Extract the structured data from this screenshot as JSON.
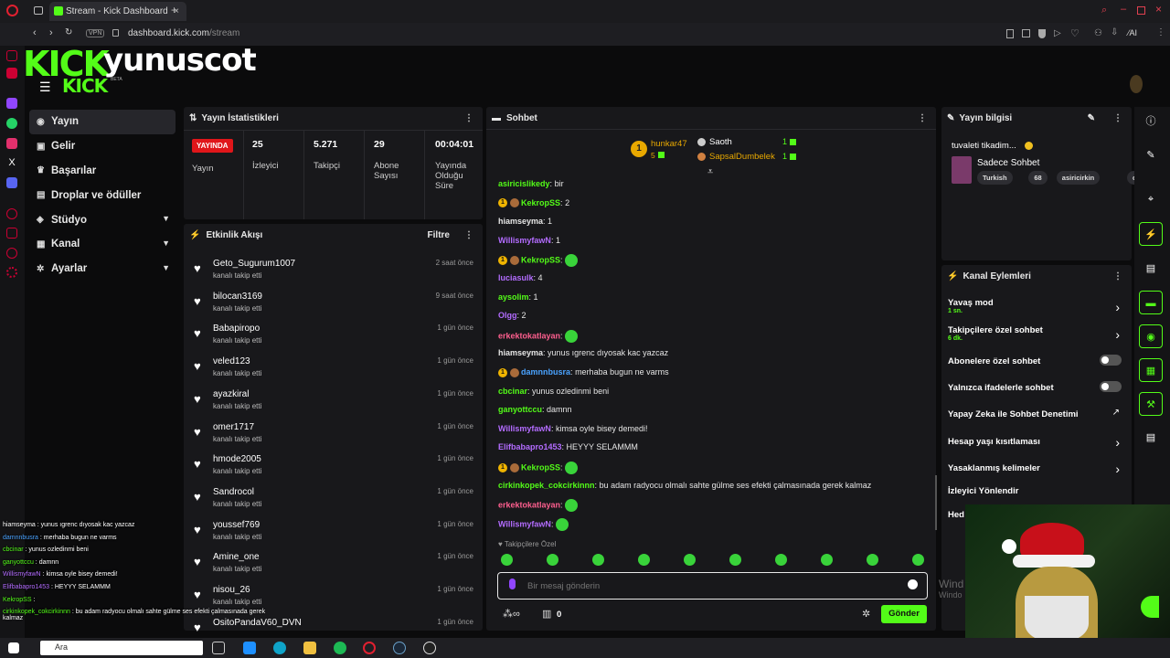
{
  "browser": {
    "tab_title": "Stream - Kick Dashboard",
    "url_host": "dashboard.kick.com",
    "url_path": "/stream",
    "vpn": "VPN",
    "new_tab": "+",
    "ai": "AI"
  },
  "overlay": {
    "logo": "KICK",
    "name": "yunuscot",
    "small_logo": "KICK",
    "beta": "BETA"
  },
  "nav": [
    {
      "label": "Yayın",
      "icon": "broadcast-icon"
    },
    {
      "label": "Gelir",
      "icon": "revenue-icon"
    },
    {
      "label": "Başarılar",
      "icon": "trophy-icon"
    },
    {
      "label": "Droplar ve ödüller",
      "icon": "drops-icon"
    },
    {
      "label": "Stüdyo",
      "icon": "studio-icon"
    },
    {
      "label": "Kanal",
      "icon": "channel-icon"
    },
    {
      "label": "Ayarlar",
      "icon": "settings-icon"
    }
  ],
  "stats": {
    "title": "Yayın İstatistikleri",
    "live": "YAYINDA",
    "live_label": "Yayın",
    "viewers": "25",
    "viewers_label": "İzleyici",
    "followers": "5.271",
    "followers_label": "Takipçi",
    "subs": "29",
    "subs_label": "Abone Sayısı",
    "uptime": "00:04:01",
    "uptime_label": "Yayında Olduğu Süre"
  },
  "feed": {
    "title": "Etkinlik Akışı",
    "filter": "Filtre",
    "items": [
      {
        "name": "Geto_Sugurum1007",
        "sub": "kanalı takip etti",
        "time": "2 saat önce"
      },
      {
        "name": "bilocan3169",
        "sub": "kanalı takip etti",
        "time": "9 saat önce"
      },
      {
        "name": "Babapiropo",
        "sub": "kanalı takip etti",
        "time": "1 gün önce"
      },
      {
        "name": "veled123",
        "sub": "kanalı takip etti",
        "time": "1 gün önce"
      },
      {
        "name": "ayazkiral",
        "sub": "kanalı takip etti",
        "time": "1 gün önce"
      },
      {
        "name": "omer1717",
        "sub": "kanalı takip etti",
        "time": "1 gün önce"
      },
      {
        "name": "hmode2005",
        "sub": "kanalı takip etti",
        "time": "1 gün önce"
      },
      {
        "name": "Sandrocol",
        "sub": "kanalı takip etti",
        "time": "1 gün önce"
      },
      {
        "name": "youssef769",
        "sub": "kanalı takip etti",
        "time": "1 gün önce"
      },
      {
        "name": "Amine_one",
        "sub": "kanalı takip etti",
        "time": "1 gün önce"
      },
      {
        "name": "nisou_26",
        "sub": "kanalı takip etti",
        "time": "1 gün önce"
      },
      {
        "name": "OsitoPandaV60_DVN",
        "sub": "",
        "time": "1 gün önce"
      }
    ]
  },
  "chat": {
    "title": "Sohbet",
    "top1_name": "hunkar47",
    "top1_count": "5",
    "top2_name": "Saoth",
    "top2_count": "1",
    "top3_name": "SapsalDumbelek",
    "top3_count": "1",
    "rank": "1",
    "messages": [
      {
        "user": "asiricislikedy",
        "color": "#53fc18",
        "text": "bir",
        "badges": false
      },
      {
        "user": "KekropSS",
        "color": "#53fc18",
        "text": "2",
        "badges": true
      },
      {
        "user": "hiamseyma",
        "color": "#e6e6e6",
        "text": "1",
        "badges": false
      },
      {
        "user": "WillismyfawN",
        "color": "#b36cff",
        "text": "1",
        "badges": false
      },
      {
        "user": "KekropSS",
        "color": "#53fc18",
        "text": "",
        "badges": true,
        "emote": true
      },
      {
        "user": "luciasulk",
        "color": "#b36cff",
        "text": "4",
        "badges": false
      },
      {
        "user": "aysolim",
        "color": "#53fc18",
        "text": "1",
        "badges": false
      },
      {
        "user": "Olgg",
        "color": "#b36cff",
        "text": "2",
        "badges": false
      },
      {
        "user": "erkektokatlayan",
        "color": "#ff5f8f",
        "text": "",
        "badges": false,
        "emote": true
      },
      {
        "user": "hiamseyma",
        "color": "#e6e6e6",
        "text": "yunus ıgrenc dıyosak kac yazcaz",
        "badges": false
      },
      {
        "user": "damnnbusra",
        "color": "#4aa3ff",
        "text": "merhaba bugun ne varms",
        "badges": true
      },
      {
        "user": "cbcinar",
        "color": "#53fc18",
        "text": "yunus ozledinmi beni",
        "badges": false
      },
      {
        "user": "ganyottccu",
        "color": "#53fc18",
        "text": "damnn",
        "badges": false
      },
      {
        "user": "WillismyfawN",
        "color": "#b36cff",
        "text": "kimsa oyle bisey demedi!",
        "badges": false
      },
      {
        "user": "Elifbabapro1453",
        "color": "#b36cff",
        "text": "HEYYY SELAMMM",
        "badges": false
      },
      {
        "user": "KekropSS",
        "color": "#53fc18",
        "text": "",
        "badges": true,
        "emote": true
      },
      {
        "user": "cirkinkopek_cokcirkinnn",
        "color": "#53fc18",
        "text": "bu adam radyocu olmalı sahte gülme ses efekti çalmasınada gerek kalmaz",
        "badges": false
      },
      {
        "user": "erkektokatlayan",
        "color": "#ff5f8f",
        "text": "",
        "badges": false,
        "emote": true
      },
      {
        "user": "WillismyfawN",
        "color": "#b36cff",
        "text": "",
        "badges": false,
        "emote": true
      }
    ],
    "followers_only": "Takipçilere Özel",
    "placeholder": "Bir mesaj gönderin",
    "send": "Gönder",
    "count": "0"
  },
  "info": {
    "title": "Yayın bilgisi",
    "stream_title": "tuvaleti tikadim...",
    "category": "Sadece Sohbet",
    "tags": [
      "Turkish",
      "68",
      "asiricirkin",
      "cirkin"
    ]
  },
  "actions": {
    "title": "Kanal Eylemleri",
    "items": [
      {
        "label": "Yavaş mod",
        "sub": "1 sn.",
        "kind": "arrow"
      },
      {
        "label": "Takipçilere özel sohbet",
        "sub": "6 dk.",
        "kind": "arrow"
      },
      {
        "label": "Abonelere özel sohbet",
        "sub": "",
        "kind": "toggle"
      },
      {
        "label": "Yalnızca ifadelerle sohbet",
        "sub": "",
        "kind": "toggle"
      },
      {
        "label": "Yapay Zeka ile Sohbet Denetimi",
        "sub": "",
        "kind": "external"
      },
      {
        "label": "Hesap yaşı kısıtlaması",
        "sub": "",
        "kind": "arrow"
      },
      {
        "label": "Yasaklanmış kelimeler",
        "sub": "",
        "kind": "arrow"
      },
      {
        "label": "İzleyici Yönlendir",
        "sub": "",
        "kind": "none"
      },
      {
        "label": "Hed",
        "sub": "",
        "kind": "none"
      }
    ]
  },
  "overlay_chat": [
    {
      "user": "hiamseyma",
      "text": "yunus ıgrenc dıyosak kac yazcaz",
      "color": "#ffffff"
    },
    {
      "user": "damnnbusra",
      "text": "merhaba bugun ne varms",
      "color": "#4aa3ff"
    },
    {
      "user": "cbcinar",
      "text": "yunus ozledinmi beni",
      "color": "#53fc18"
    },
    {
      "user": "ganyottccu",
      "text": "damnn",
      "color": "#53fc18"
    },
    {
      "user": "WillismyfawN",
      "text": "kimsa oyle bisey demedi!",
      "color": "#b36cff"
    },
    {
      "user": "Elifbabapro1453",
      "text": "HEYYY SELAMMM",
      "color": "#b36cff"
    },
    {
      "user": "KekropSS",
      "text": "",
      "color": "#53fc18"
    },
    {
      "user": "cirkinkopek_cokcirkinnn",
      "text": "bu adam radyocu olmalı sahte gülme ses efekti çalmasınada gerek kalmaz",
      "color": "#53fc18"
    }
  ],
  "taskbar": {
    "search": "Ara"
  },
  "watermark": {
    "line1": "Wind",
    "line2": "Windo"
  }
}
